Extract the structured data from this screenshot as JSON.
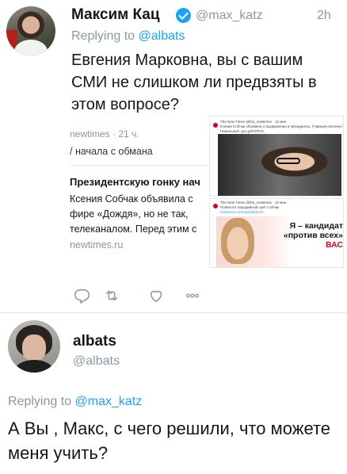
{
  "tweet1": {
    "author_name": "Максим Кац",
    "handle": "@max_katz",
    "time": "2h",
    "replying_to_prefix": "Replying to ",
    "replying_to_handle": "@albats",
    "text": "Евгения Марковна, вы с вашим СМИ не слишком ли предвзяты в этом вопросе?",
    "quoted": {
      "meta": "newtimes · 21 ч.",
      "line1": "/ начала с обмана",
      "title": "Президентскую гонку нач",
      "body": [
        "Ксения Собчак объявила с",
        "фире «Дождя», но не так,",
        "телеканалом. Перед этим с"
      ],
      "site": "newtimes.ru"
    },
    "screenshot_top": {
      "mini1": "The New Times @the_newtimes · 12 мин.",
      "mini2": "Ксения Собчак объявила о выдвижении в президенты. Главный оппонент",
      "mini3": "Навальный. goo.gl/K2Pb7L"
    },
    "screenshot_bottom": {
      "mini1": "The New Times @the_newtimes · 12 мин.",
      "mini2": "Появился пародийный сайт Собчак",
      "mini3": "newtimes.ru/news/detail.ph...",
      "banner_line1": "Я – кандидат",
      "banner_line2": "«против всех»",
      "banner_line3": "ВАС"
    },
    "actions": {
      "reply_icon": "reply-icon",
      "retweet_icon": "retweet-icon",
      "like_icon": "heart-icon",
      "more_icon": "more-icon"
    }
  },
  "tweet2": {
    "author_name": "albats",
    "handle": "@albats",
    "replying_to_prefix": "Replying to ",
    "replying_to_handle": "@max_katz",
    "text": "А Вы , Макс, с чего решили, что можете меня учить?"
  },
  "colors": {
    "accent": "#1da1f2",
    "secondary_text": "#8899a6",
    "primary_text": "#14171a",
    "divider": "#e1e8ed"
  }
}
